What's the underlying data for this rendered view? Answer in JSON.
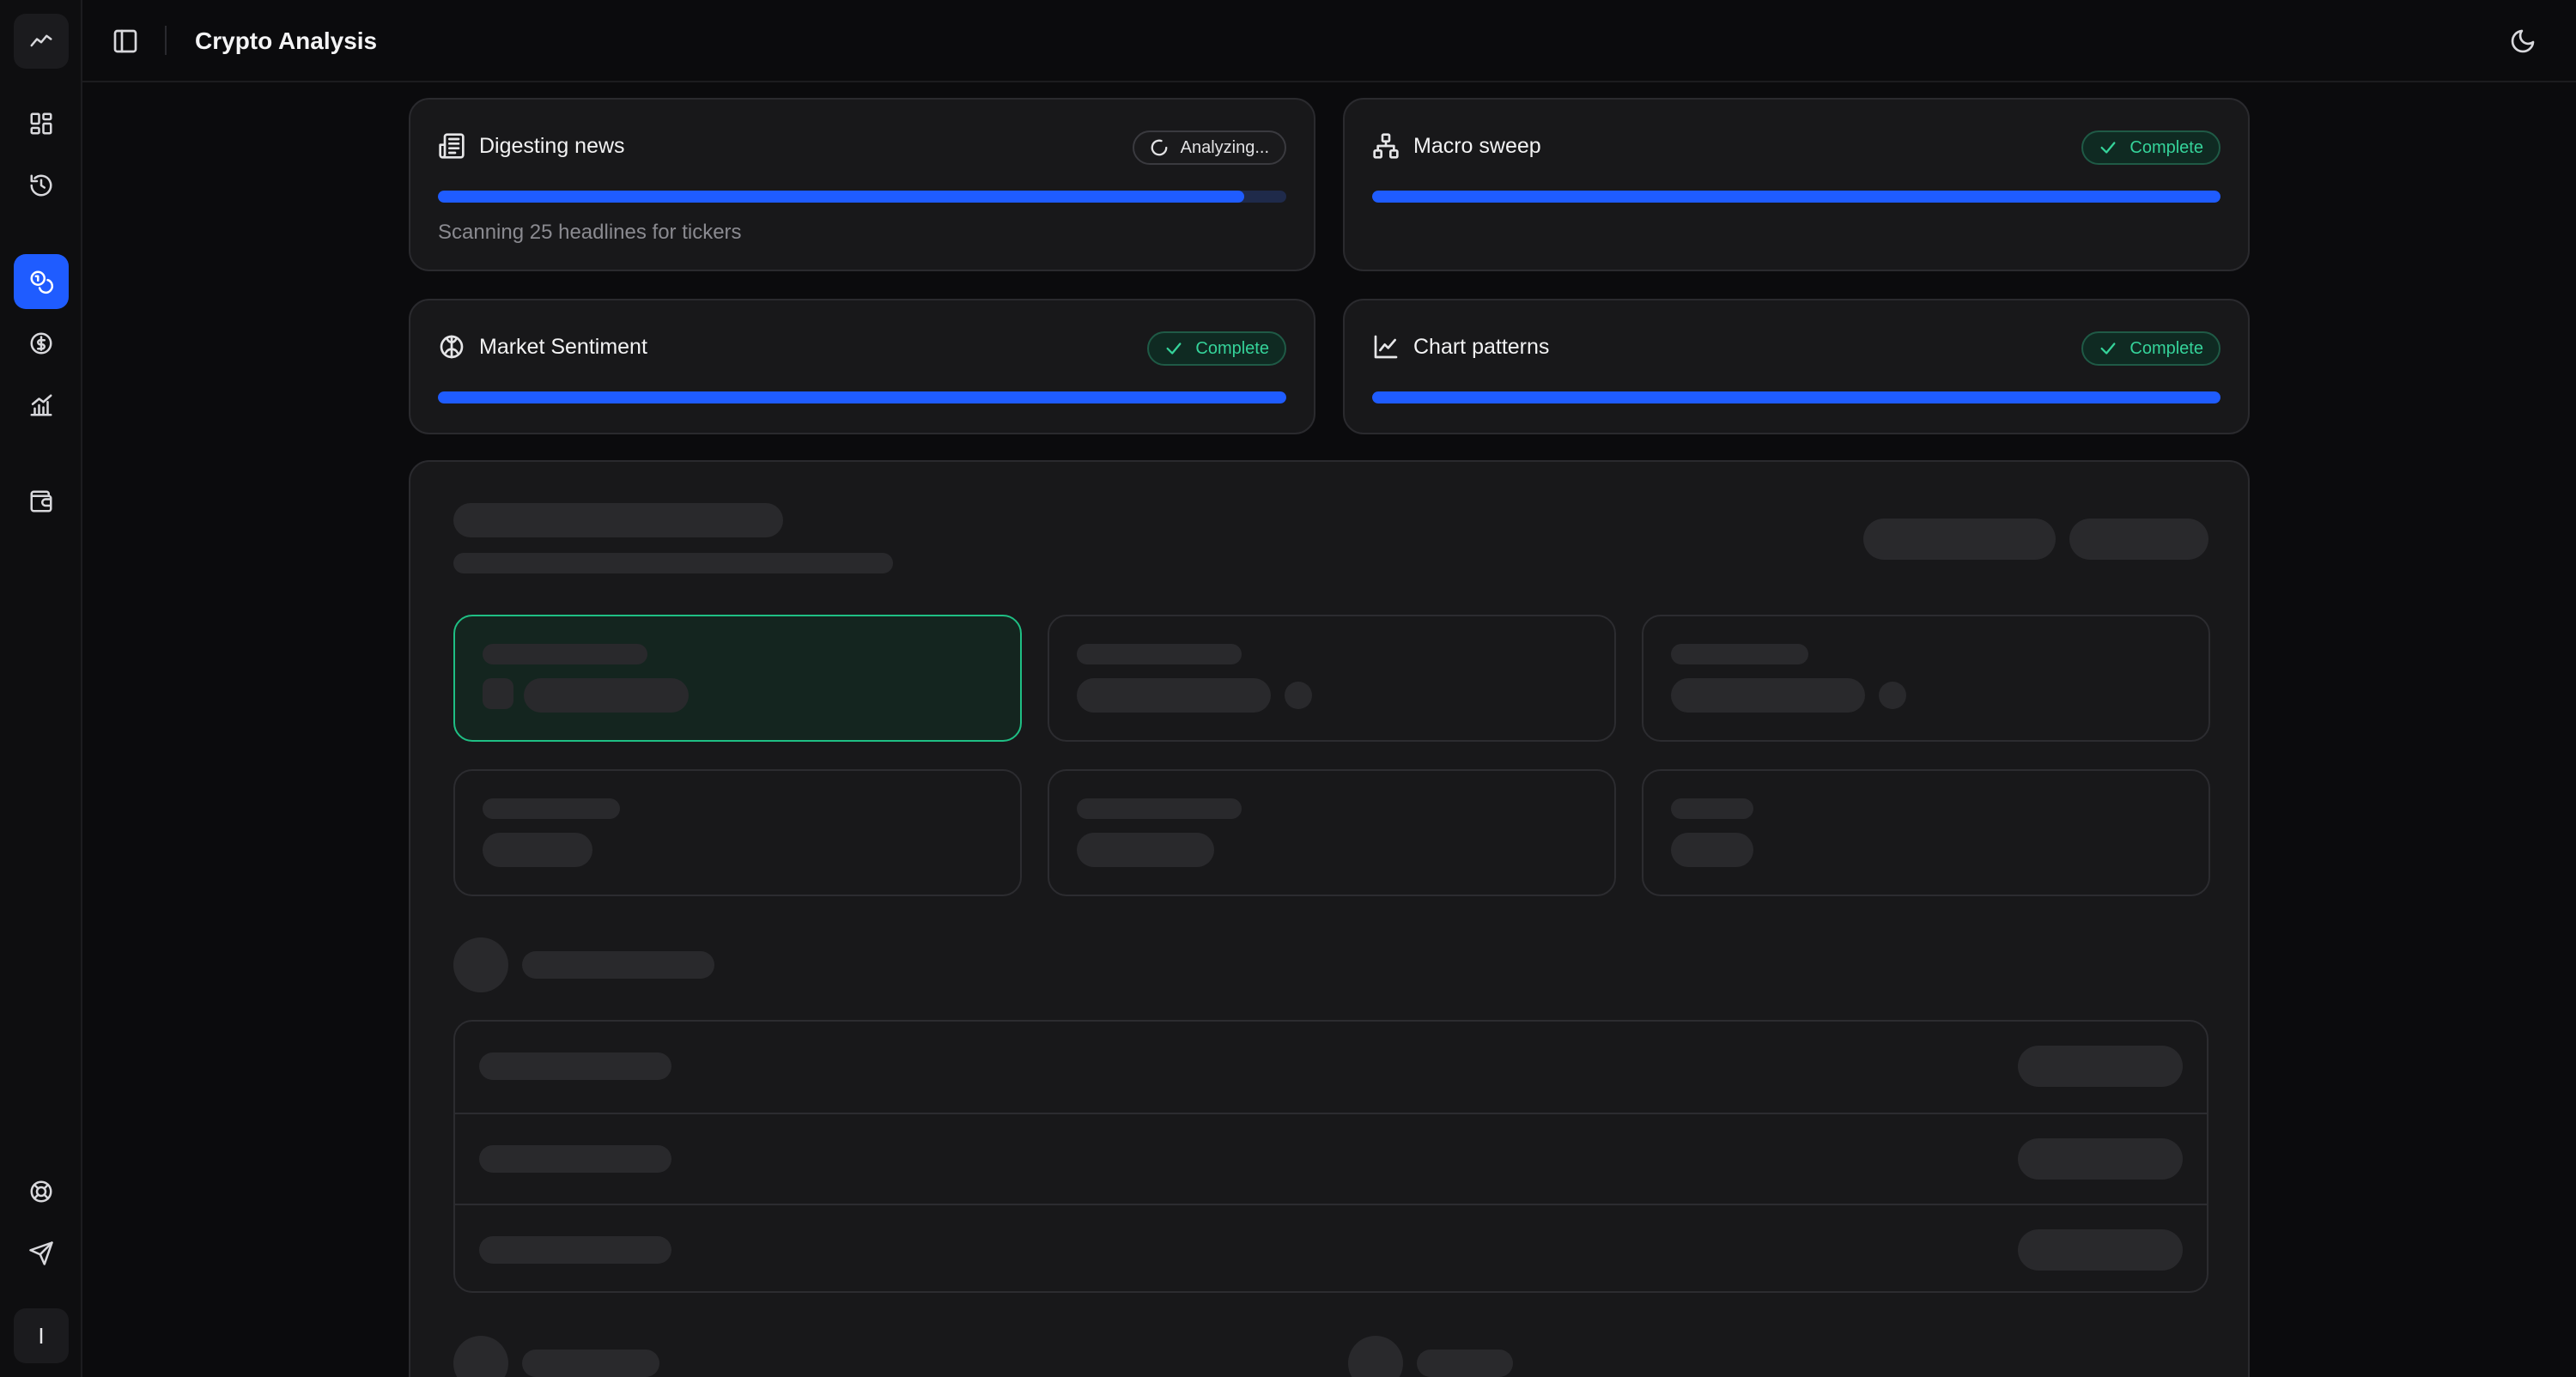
{
  "app": {
    "title": "Crypto Analysis",
    "accent": "#1f5cff",
    "success": "#35d39a"
  },
  "sidebar": {
    "items": [
      {
        "name": "logo",
        "icon": "trend-line-icon"
      },
      {
        "name": "dashboard",
        "icon": "layout-grid-icon"
      },
      {
        "name": "history",
        "icon": "history-icon"
      },
      {
        "name": "crypto-analysis",
        "icon": "coins-icon",
        "active": true
      },
      {
        "name": "currency",
        "icon": "dollar-circle-icon"
      },
      {
        "name": "charts",
        "icon": "chart-bars-icon"
      },
      {
        "name": "wallet",
        "icon": "wallet-icon"
      },
      {
        "name": "help",
        "icon": "lifebuoy-icon"
      },
      {
        "name": "send",
        "icon": "send-icon"
      }
    ],
    "user_initial": "I"
  },
  "status_cards": [
    {
      "title": "Digesting news",
      "status": "Analyzing...",
      "state": "analyzing",
      "progress": 0.95,
      "subtitle": "Scanning 25 headlines for tickers",
      "icon": "newspaper-icon"
    },
    {
      "title": "Macro sweep",
      "status": "Complete",
      "state": "complete",
      "progress": 1.0,
      "icon": "network-icon"
    },
    {
      "title": "Market Sentiment",
      "status": "Complete",
      "state": "complete",
      "progress": 1.0,
      "icon": "brain-icon"
    },
    {
      "title": "Chart patterns",
      "status": "Complete",
      "state": "complete",
      "progress": 1.0,
      "icon": "line-chart-icon"
    }
  ]
}
